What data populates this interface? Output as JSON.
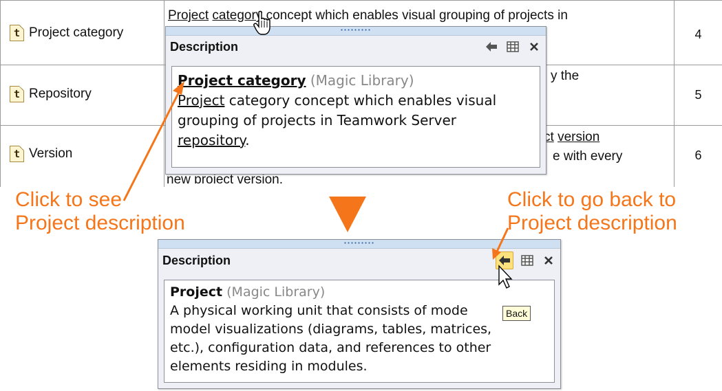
{
  "table": {
    "rows": [
      {
        "name": "Project category",
        "num": "4"
      },
      {
        "name": "Repository",
        "num": "5"
      },
      {
        "name": "Version",
        "num": "6"
      }
    ],
    "desc_row1_a": "Project",
    "desc_row1_b": "category",
    "desc_row1_c": " concept which enables visual grouping of projects in",
    "desc_row2_frag": "y the",
    "desc_row3_frag1": "ct",
    "desc_row3_frag2": "version",
    "desc_row3_frag3": "e with every",
    "desc_row3_line2_a": "new ",
    "desc_row3_line2_b": "project",
    "desc_row3_line2_c": " ",
    "desc_row3_line2_d": "version",
    "desc_row3_line2_e": "."
  },
  "popup_top": {
    "title": "Description",
    "body_title": "Project category",
    "body_lib": "(Magic Library)",
    "body_link": "Project",
    "body_line1_rest": " category concept which enables visual",
    "body_line2": "grouping of projects in Teamwork Server",
    "body_link2": "repository",
    "body_line3_end": "."
  },
  "popup_bottom": {
    "title": "Description",
    "body_title": "Project",
    "body_lib": "(Magic Library)",
    "lines": [
      "A physical working unit that consists of mode",
      "model visualizations (diagrams, tables, matrices,",
      "etc.), configuration data, and references to other",
      "elements residing in modules."
    ],
    "tooltip": "Back"
  },
  "annotations": {
    "left_line1": "Click to see",
    "left_line2": "Project description",
    "right_line1": "Click to go back to",
    "right_line2": "Project description"
  },
  "colors": {
    "accent": "#f5761a",
    "grip": "#cfe0f2",
    "button_active": "#fbe27e"
  }
}
